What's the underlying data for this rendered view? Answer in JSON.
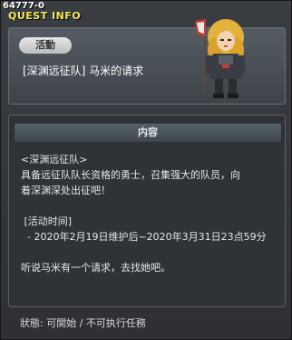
{
  "window": {
    "quest_id": "64777-0",
    "title": "QUEST INFO"
  },
  "header": {
    "category_badge": "活動",
    "quest_name": "[深渊远征队] 马米的请求",
    "npc_icon": "npc-portrait-icon"
  },
  "content": {
    "section_title": "内容",
    "lines": [
      "<深渊远征队>",
      "具备远征队队长资格的勇士，召集强大的队员，向",
      "着深渊深处出征吧！",
      "",
      " [活动时间]",
      "  - 2020年2月19日维护后~2020年3月31日23点59分",
      "",
      "听说马米有一个请求，去找她吧。"
    ]
  },
  "status": {
    "text": "狀態: 可開始 / 不可执行任務"
  },
  "colors": {
    "title_accent": "#f2e95a",
    "window_bg": "#2e3035",
    "header_bg": "#4a5057"
  }
}
